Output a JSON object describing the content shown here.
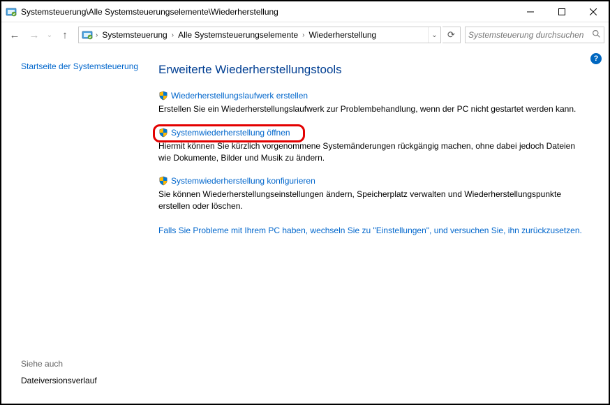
{
  "window": {
    "title": "Systemsteuerung\\Alle Systemsteuerungselemente\\Wiederherstellung"
  },
  "breadcrumbs": {
    "item0": "Systemsteuerung",
    "item1": "Alle Systemsteuerungselemente",
    "item2": "Wiederherstellung"
  },
  "search": {
    "placeholder": "Systemsteuerung durchsuchen"
  },
  "sidebar": {
    "home": "Startseite der Systemsteuerung",
    "seealso_header": "Siehe auch",
    "seealso_link": "Dateiversionsverlauf"
  },
  "main": {
    "heading": "Erweiterte Wiederherstellungstools",
    "items": [
      {
        "link": "Wiederherstellungslaufwerk erstellen",
        "desc": "Erstellen Sie ein Wiederherstellungslaufwerk zur Problembehandlung, wenn der PC nicht gestartet werden kann."
      },
      {
        "link": "Systemwiederherstellung öffnen",
        "desc": "Hiermit können Sie kürzlich vorgenommene Systemänderungen rückgängig machen, ohne dabei jedoch Dateien wie Dokumente, Bilder und Musik zu ändern."
      },
      {
        "link": "Systemwiederherstellung konfigurieren",
        "desc": "Sie können Wiederherstellungseinstellungen ändern, Speicherplatz verwalten und Wiederherstellungspunkte erstellen oder löschen."
      }
    ],
    "footer_link": "Falls Sie Probleme mit Ihrem PC haben, wechseln Sie zu \"Einstellungen\", und versuchen Sie, ihn zurückzusetzen."
  }
}
